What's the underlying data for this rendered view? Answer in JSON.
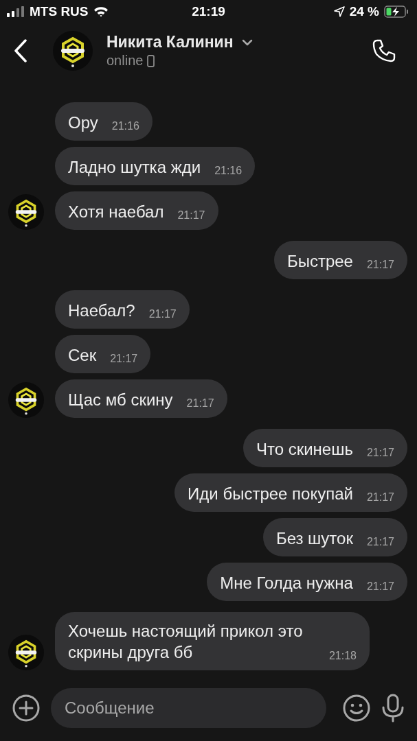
{
  "status_bar": {
    "carrier": "MTS RUS",
    "time": "21:19",
    "battery": "24 %"
  },
  "header": {
    "name": "Никита Калинин",
    "presence": "online"
  },
  "messages": [
    {
      "kind": "in",
      "text": "Ору",
      "time": "21:16",
      "show_avatar": false
    },
    {
      "kind": "in",
      "text": "Ладно шутка жди",
      "time": "21:16",
      "show_avatar": false
    },
    {
      "kind": "in",
      "text": "Хотя наебал",
      "time": "21:17",
      "show_avatar": true
    },
    {
      "kind": "out",
      "text": "Быстрее",
      "time": "21:17"
    },
    {
      "kind": "in",
      "text": "Наебал?",
      "time": "21:17",
      "show_avatar": false
    },
    {
      "kind": "in",
      "text": "Сек",
      "time": "21:17",
      "show_avatar": false
    },
    {
      "kind": "in",
      "text": "Щас мб скину",
      "time": "21:17",
      "show_avatar": true
    },
    {
      "kind": "out",
      "text": "Что скинешь",
      "time": "21:17"
    },
    {
      "kind": "out",
      "text": "Иди быстрее покупай",
      "time": "21:17"
    },
    {
      "kind": "out",
      "text": "Без шуток",
      "time": "21:17"
    },
    {
      "kind": "out",
      "text": "Мне Голда нужна",
      "time": "21:17"
    },
    {
      "kind": "in",
      "text": "Хочешь настоящий прикол это скрины друга бб",
      "time": "21:18",
      "show_avatar": true
    }
  ],
  "composer": {
    "placeholder": "Сообщение"
  }
}
